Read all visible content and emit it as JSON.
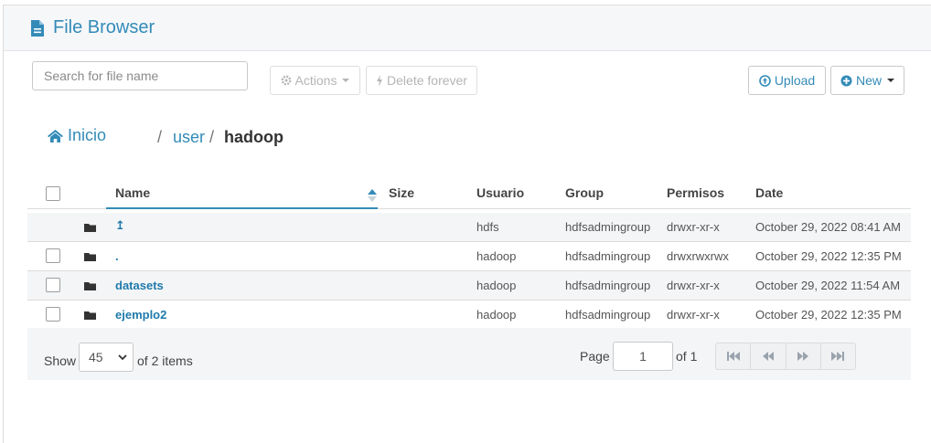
{
  "app": {
    "title": "File Browser",
    "icon": "file-icon"
  },
  "toolbar": {
    "search_placeholder": "Search for file name",
    "actions_label": "Actions",
    "delete_label": "Delete forever",
    "upload_label": "Upload",
    "new_label": "New"
  },
  "breadcrumb": {
    "home": "Inicio",
    "sep": "/",
    "parts": [
      "user",
      "hadoop"
    ]
  },
  "table": {
    "headers": {
      "name": "Name",
      "size": "Size",
      "user": "Usuario",
      "group": "Group",
      "perms": "Permisos",
      "date": "Date"
    },
    "rows": [
      {
        "name": "↥",
        "size": "",
        "user": "hdfs",
        "group": "hdfsadmingroup",
        "perms": "drwxr-xr-x",
        "date": "October 29, 2022 08:41 AM"
      },
      {
        "name": ".",
        "size": "",
        "user": "hadoop",
        "group": "hdfsadmingroup",
        "perms": "drwxrwxrwx",
        "date": "October 29, 2022 12:35 PM"
      },
      {
        "name": "datasets",
        "size": "",
        "user": "hadoop",
        "group": "hdfsadmingroup",
        "perms": "drwxr-xr-x",
        "date": "October 29, 2022 11:54 AM"
      },
      {
        "name": "ejemplo2",
        "size": "",
        "user": "hadoop",
        "group": "hdfsadmingroup",
        "perms": "drwxr-xr-x",
        "date": "October 29, 2022 12:35 PM"
      }
    ]
  },
  "pagination": {
    "show_label": "Show",
    "page_size": "45",
    "items_label": "of 2 items",
    "page_label": "Page",
    "current_page": "1",
    "of_label": "of 1"
  },
  "colors": {
    "accent": "#338bb8",
    "link": "#1f7aaa"
  }
}
